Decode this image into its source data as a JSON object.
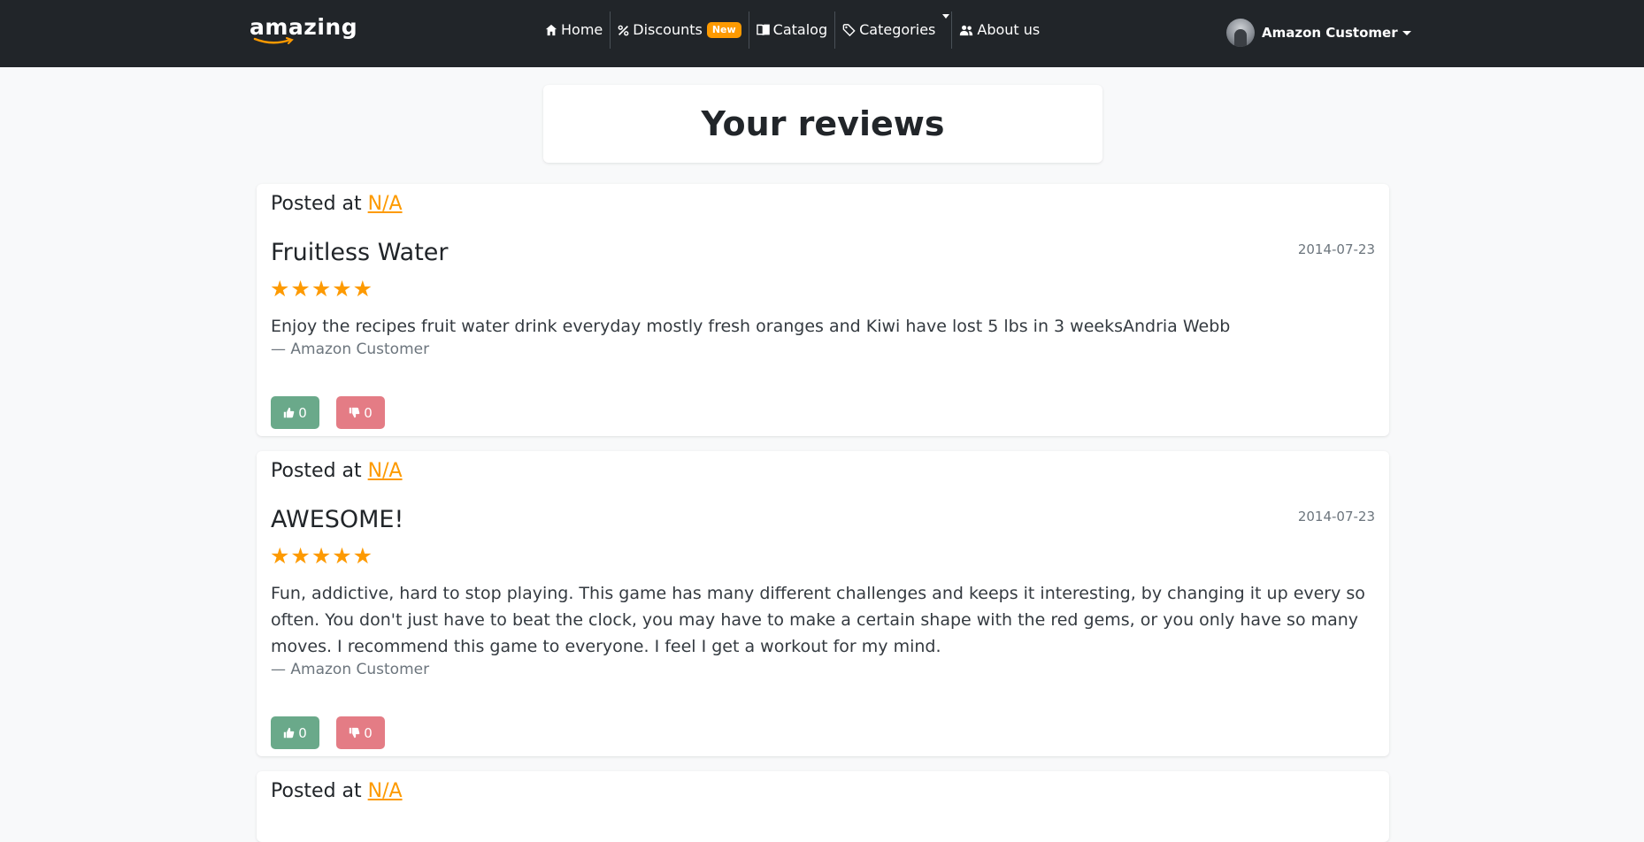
{
  "navbar": {
    "brand": "amazing",
    "items": [
      {
        "label": "Home",
        "icon": "home-icon"
      },
      {
        "label": "Discounts",
        "icon": "percent-icon",
        "badge": "New"
      },
      {
        "label": "Catalog",
        "icon": "book-icon"
      },
      {
        "label": "Categories",
        "icon": "tags-icon"
      },
      {
        "label": "About us",
        "icon": "users-icon"
      }
    ],
    "user": {
      "name": "Amazon Customer"
    }
  },
  "page": {
    "title": "Your reviews"
  },
  "colors": {
    "accent": "#fd9a01",
    "navbar_bg": "#212529",
    "upvote": "#6aa98a",
    "downvote": "#e47c85"
  },
  "reviews": [
    {
      "posted_prefix": "Posted at",
      "posted_link": "N/A",
      "title": "Fruitless Water",
      "date": "2014-07-23",
      "stars": "★★★★★",
      "rating": 5,
      "body": "Enjoy the recipes fruit water drink everyday mostly fresh oranges and Kiwi have lost 5 lbs in 3 weeksAndria Webb",
      "author": "— Amazon Customer",
      "upvotes": "0",
      "downvotes": "0"
    },
    {
      "posted_prefix": "Posted at",
      "posted_link": "N/A",
      "title": "AWESOME!",
      "date": "2014-07-23",
      "stars": "★★★★★",
      "rating": 5,
      "body": "Fun, addictive, hard to stop playing. This game has many different challenges and keeps it interesting, by changing it up every so often. You don't just have to beat the clock, you may have to make a certain shape with the red gems, or you only have so many moves. I recommend this game to everyone. I feel I get a workout for my mind.",
      "author": "— Amazon Customer",
      "upvotes": "0",
      "downvotes": "0"
    },
    {
      "posted_prefix": "Posted at",
      "posted_link": "N/A"
    }
  ]
}
